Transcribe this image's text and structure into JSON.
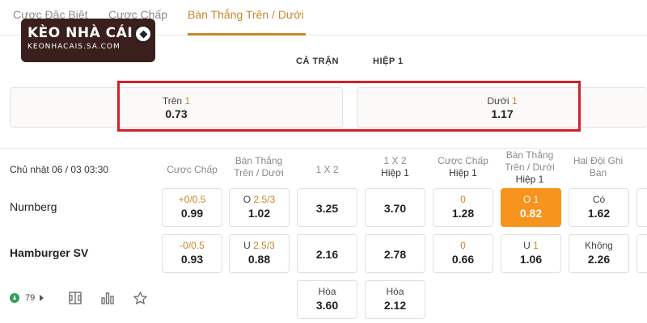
{
  "tabs": [
    {
      "label": "Cược Đặc Biệt"
    },
    {
      "label": "Cược Chấp"
    },
    {
      "label": "Bàn Thắng Trên / Dưới"
    }
  ],
  "logo": {
    "title": "KÈO NHÀ CÁI",
    "subtitle": "KEONHACAIS.SA.COM"
  },
  "periods": {
    "full": "CẢ TRẬN",
    "half": "HIỆP 1"
  },
  "over_under": {
    "over": {
      "label": "Trên",
      "line": "1",
      "odds": "0.73"
    },
    "under": {
      "label": "Dưới",
      "line": "1",
      "odds": "1.17"
    }
  },
  "match": {
    "date": "Chủ nhật 06 / 03 03:30",
    "headers": {
      "h1": "Cược Chấp",
      "h2a": "Bàn Thắng",
      "h2b": "Trên / Dưới",
      "h3": "1 X 2",
      "h4a": "1 X 2",
      "h4b": "Hiệp 1",
      "h5a": "Cược Chấp",
      "h5b": "Hiệp 1",
      "h6a": "Bàn Thắng",
      "h6b": "Trên / Dưới",
      "h6c": "Hiệp 1",
      "h7a": "Hai Đội Ghi",
      "h7b": "Bàn"
    },
    "home": {
      "name": "Nurnberg",
      "handicap": {
        "line": "+0/0.5",
        "odds": "0.99"
      },
      "ou": {
        "side": "O",
        "line": "2.5/3",
        "odds": "1.02"
      },
      "x12": "3.25",
      "x12_h1": "3.70",
      "handicap_h1": {
        "line": "0",
        "odds": "1.28"
      },
      "ou_h1": {
        "side": "O",
        "line": "1",
        "odds": "0.82"
      },
      "btts": {
        "label": "Có",
        "odds": "1.62"
      }
    },
    "away": {
      "name": "Hamburger SV",
      "handicap": {
        "line": "-0/0.5",
        "odds": "0.93"
      },
      "ou": {
        "side": "U",
        "line": "2.5/3",
        "odds": "0.88"
      },
      "x12": "2.16",
      "x12_h1": "2.78",
      "handicap_h1": {
        "line": "0",
        "odds": "0.66"
      },
      "ou_h1": {
        "side": "U",
        "line": "1",
        "odds": "1.06"
      },
      "btts": {
        "label": "Không",
        "odds": "2.26"
      }
    },
    "draw": {
      "x12": {
        "label": "Hòa",
        "odds": "3.60"
      },
      "x12_h1": {
        "label": "Hòa",
        "odds": "2.12"
      }
    }
  },
  "footer": {
    "markets_count": "79"
  },
  "colors": {
    "accent": "#c8862a",
    "highlight": "#f7941d",
    "frame": "#d3202b",
    "live": "#2e9e5b"
  }
}
